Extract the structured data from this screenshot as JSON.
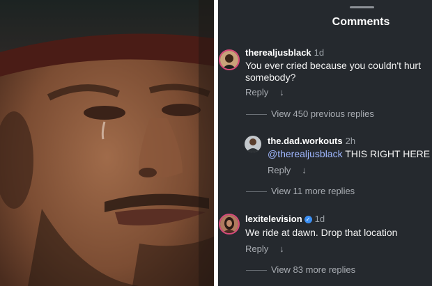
{
  "header": {
    "title": "Comments"
  },
  "comments": [
    {
      "username": "therealjusblack",
      "time": "1d",
      "text_line1": "You ever cried because you couldn't hurt",
      "text_line2": "somebody?",
      "reply_label": "Reply",
      "more_replies": "View 450 previous replies"
    },
    {
      "username": "the.dad.workouts",
      "time": "2h",
      "mention": "@therealjusblack",
      "text": " THIS RIGHT HERE",
      "reply_label": "Reply",
      "more_replies": "View 11 more replies"
    },
    {
      "username": "lexitelevision",
      "time": "1d",
      "text": "We ride at dawn. Drop that location",
      "reply_label": "Reply",
      "more_replies": "View 83 more replies"
    }
  ],
  "icons": {
    "reply_arrow": "down-arrow-icon",
    "verified": "verified-badge-icon"
  },
  "colors": {
    "panel_bg": "#25292e",
    "mention": "#9fb7ff",
    "verified": "#3b8ff3",
    "avatar_ring": "#d84a7a"
  }
}
